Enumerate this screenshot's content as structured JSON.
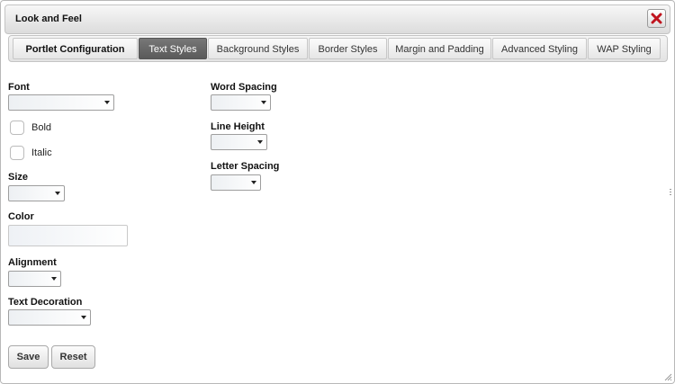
{
  "dialog": {
    "title": "Look and Feel",
    "close_icon": "close-icon"
  },
  "tabs": [
    {
      "label": "Portlet Configuration",
      "active": false
    },
    {
      "label": "Text Styles",
      "active": true
    },
    {
      "label": "Background Styles",
      "active": false
    },
    {
      "label": "Border Styles",
      "active": false
    },
    {
      "label": "Margin and Padding",
      "active": false
    },
    {
      "label": "Advanced Styling",
      "active": false
    },
    {
      "label": "WAP Styling",
      "active": false
    }
  ],
  "form": {
    "font": {
      "label": "Font",
      "value": ""
    },
    "bold": {
      "label": "Bold",
      "checked": false
    },
    "italic": {
      "label": "Italic",
      "checked": false
    },
    "size": {
      "label": "Size",
      "value": ""
    },
    "color": {
      "label": "Color",
      "value": ""
    },
    "alignment": {
      "label": "Alignment",
      "value": ""
    },
    "text_decoration": {
      "label": "Text Decoration",
      "value": ""
    },
    "word_spacing": {
      "label": "Word Spacing",
      "value": ""
    },
    "line_height": {
      "label": "Line Height",
      "value": ""
    },
    "letter_spacing": {
      "label": "Letter Spacing",
      "value": ""
    }
  },
  "buttons": {
    "save": "Save",
    "reset": "Reset"
  },
  "colors": {
    "active_tab": "#5f5f5f",
    "close_x": "#c0141e"
  }
}
